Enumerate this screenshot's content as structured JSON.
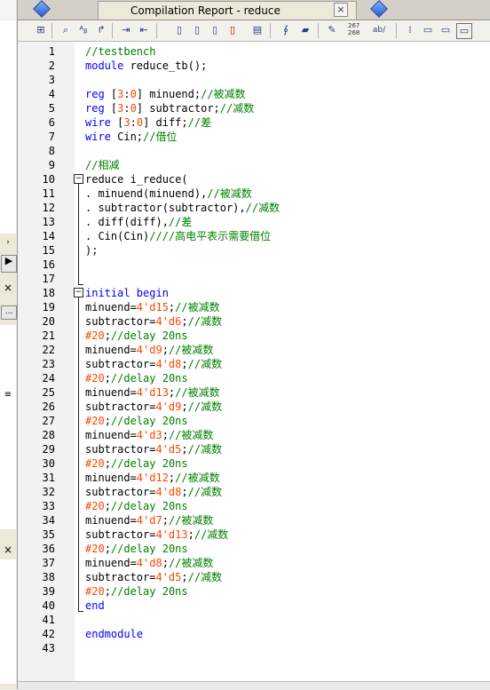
{
  "window": {
    "tab_title": "Compilation Report - reduce",
    "tab_close": "×"
  },
  "left_panel": {
    "close_glyph": "×",
    "ellipsis": "...",
    "scroll_glyph": "≡"
  },
  "toolbar": {
    "counter_top": "267",
    "counter_bottom": "268",
    "ab_label": "ab/",
    "icons": [
      "insert-template-icon",
      "find-icon",
      "find-replace-icon",
      "goto-icon",
      "indent-icon",
      "unindent-icon",
      "bookmark-toggle-icon",
      "bookmark-next-icon",
      "bookmark-prev-icon",
      "bookmark-clear-icon",
      "bookmark-list-icon",
      "attach-icon",
      "comment-icon",
      "block-comment-icon",
      "line-numbers-icon",
      "word-wrap-icon",
      "cursor-icon",
      "align-left-icon",
      "align-right-icon",
      "toggle-view-icon"
    ]
  },
  "editor": {
    "lines": [
      {
        "n": "1",
        "t": [
          {
            "c": "cm",
            "s": "//testbench"
          }
        ]
      },
      {
        "n": "2",
        "t": [
          {
            "c": "kw",
            "s": "module"
          },
          {
            "c": "",
            "s": " reduce_tb();"
          }
        ]
      },
      {
        "n": "3",
        "t": []
      },
      {
        "n": "4",
        "t": [
          {
            "c": "kw",
            "s": "reg"
          },
          {
            "c": "",
            "s": " "
          },
          {
            "c": "",
            "s": "["
          },
          {
            "c": "nm",
            "s": "3"
          },
          {
            "c": "",
            "s": ":"
          },
          {
            "c": "nm",
            "s": "0"
          },
          {
            "c": "",
            "s": "] minuend;"
          },
          {
            "c": "cm",
            "s": "//被减数"
          }
        ]
      },
      {
        "n": "5",
        "t": [
          {
            "c": "kw",
            "s": "reg"
          },
          {
            "c": "",
            "s": " ["
          },
          {
            "c": "nm",
            "s": "3"
          },
          {
            "c": "",
            "s": ":"
          },
          {
            "c": "nm",
            "s": "0"
          },
          {
            "c": "",
            "s": "] subtractor;"
          },
          {
            "c": "cm",
            "s": "//减数"
          }
        ]
      },
      {
        "n": "6",
        "t": [
          {
            "c": "kw",
            "s": "wire"
          },
          {
            "c": "",
            "s": " ["
          },
          {
            "c": "nm",
            "s": "3"
          },
          {
            "c": "",
            "s": ":"
          },
          {
            "c": "nm",
            "s": "0"
          },
          {
            "c": "",
            "s": "] diff;"
          },
          {
            "c": "cm",
            "s": "//差"
          }
        ]
      },
      {
        "n": "7",
        "t": [
          {
            "c": "kw",
            "s": "wire"
          },
          {
            "c": "",
            "s": " Cin;"
          },
          {
            "c": "cm",
            "s": "//借位"
          }
        ]
      },
      {
        "n": "8",
        "t": []
      },
      {
        "n": "9",
        "t": [
          {
            "c": "cm",
            "s": "//相减"
          }
        ]
      },
      {
        "n": "10",
        "t": [
          {
            "c": "",
            "s": "reduce i_reduce("
          }
        ]
      },
      {
        "n": "11",
        "t": [
          {
            "c": "",
            "s": ". minuend(minuend),"
          },
          {
            "c": "cm",
            "s": "//被减数"
          }
        ]
      },
      {
        "n": "12",
        "t": [
          {
            "c": "",
            "s": ". subtractor(subtractor),"
          },
          {
            "c": "cm",
            "s": "//减数"
          }
        ]
      },
      {
        "n": "13",
        "t": [
          {
            "c": "",
            "s": ". diff(diff),"
          },
          {
            "c": "cm",
            "s": "//差"
          }
        ]
      },
      {
        "n": "14",
        "t": [
          {
            "c": "",
            "s": ". Cin(Cin)"
          },
          {
            "c": "cm",
            "s": "////高电平表示需要借位"
          }
        ]
      },
      {
        "n": "15",
        "t": [
          {
            "c": "",
            "s": ");"
          }
        ]
      },
      {
        "n": "16",
        "t": []
      },
      {
        "n": "17",
        "t": []
      },
      {
        "n": "18",
        "t": [
          {
            "c": "kw",
            "s": "initial begin"
          }
        ]
      },
      {
        "n": "19",
        "t": [
          {
            "c": "",
            "s": "minuend="
          },
          {
            "c": "nm",
            "s": "4'd15"
          },
          {
            "c": "",
            "s": ";"
          },
          {
            "c": "cm",
            "s": "//被减数"
          }
        ]
      },
      {
        "n": "20",
        "t": [
          {
            "c": "",
            "s": "subtractor="
          },
          {
            "c": "nm",
            "s": "4'd6"
          },
          {
            "c": "",
            "s": ";"
          },
          {
            "c": "cm",
            "s": "//减数"
          }
        ]
      },
      {
        "n": "21",
        "t": [
          {
            "c": "nm",
            "s": "#20"
          },
          {
            "c": "",
            "s": ";"
          },
          {
            "c": "cm",
            "s": "//delay 20ns"
          }
        ]
      },
      {
        "n": "22",
        "t": [
          {
            "c": "",
            "s": "minuend="
          },
          {
            "c": "nm",
            "s": "4'd9"
          },
          {
            "c": "",
            "s": ";"
          },
          {
            "c": "cm",
            "s": "//被减数"
          }
        ]
      },
      {
        "n": "23",
        "t": [
          {
            "c": "",
            "s": "subtractor="
          },
          {
            "c": "nm",
            "s": "4'd8"
          },
          {
            "c": "",
            "s": ";"
          },
          {
            "c": "cm",
            "s": "//减数"
          }
        ]
      },
      {
        "n": "24",
        "t": [
          {
            "c": "nm",
            "s": "#20"
          },
          {
            "c": "",
            "s": ";"
          },
          {
            "c": "cm",
            "s": "//delay 20ns"
          }
        ]
      },
      {
        "n": "25",
        "t": [
          {
            "c": "",
            "s": "minuend="
          },
          {
            "c": "nm",
            "s": "4'd13"
          },
          {
            "c": "",
            "s": ";"
          },
          {
            "c": "cm",
            "s": "//被减数"
          }
        ]
      },
      {
        "n": "26",
        "t": [
          {
            "c": "",
            "s": "subtractor="
          },
          {
            "c": "nm",
            "s": "4'd9"
          },
          {
            "c": "",
            "s": ";"
          },
          {
            "c": "cm",
            "s": "//减数"
          }
        ]
      },
      {
        "n": "27",
        "t": [
          {
            "c": "nm",
            "s": "#20"
          },
          {
            "c": "",
            "s": ";"
          },
          {
            "c": "cm",
            "s": "//delay 20ns"
          }
        ]
      },
      {
        "n": "28",
        "t": [
          {
            "c": "",
            "s": "minuend="
          },
          {
            "c": "nm",
            "s": "4'd3"
          },
          {
            "c": "",
            "s": ";"
          },
          {
            "c": "cm",
            "s": "//被减数"
          }
        ]
      },
      {
        "n": "29",
        "t": [
          {
            "c": "",
            "s": "subtractor="
          },
          {
            "c": "nm",
            "s": "4'd5"
          },
          {
            "c": "",
            "s": ";"
          },
          {
            "c": "cm",
            "s": "//减数"
          }
        ]
      },
      {
        "n": "30",
        "t": [
          {
            "c": "nm",
            "s": "#20"
          },
          {
            "c": "",
            "s": ";"
          },
          {
            "c": "cm",
            "s": "//delay 20ns"
          }
        ]
      },
      {
        "n": "31",
        "t": [
          {
            "c": "",
            "s": "minuend="
          },
          {
            "c": "nm",
            "s": "4'd12"
          },
          {
            "c": "",
            "s": ";"
          },
          {
            "c": "cm",
            "s": "//被减数"
          }
        ]
      },
      {
        "n": "32",
        "t": [
          {
            "c": "",
            "s": "subtractor="
          },
          {
            "c": "nm",
            "s": "4'd8"
          },
          {
            "c": "",
            "s": ";"
          },
          {
            "c": "cm",
            "s": "//减数"
          }
        ]
      },
      {
        "n": "33",
        "t": [
          {
            "c": "nm",
            "s": "#20"
          },
          {
            "c": "",
            "s": ";"
          },
          {
            "c": "cm",
            "s": "//delay 20ns"
          }
        ]
      },
      {
        "n": "34",
        "t": [
          {
            "c": "",
            "s": "minuend="
          },
          {
            "c": "nm",
            "s": "4'd7"
          },
          {
            "c": "",
            "s": ";"
          },
          {
            "c": "cm",
            "s": "//被减数"
          }
        ]
      },
      {
        "n": "35",
        "t": [
          {
            "c": "",
            "s": "subtractor="
          },
          {
            "c": "nm",
            "s": "4'd13"
          },
          {
            "c": "",
            "s": ";"
          },
          {
            "c": "cm",
            "s": "//减数"
          }
        ]
      },
      {
        "n": "36",
        "t": [
          {
            "c": "nm",
            "s": "#20"
          },
          {
            "c": "",
            "s": ";"
          },
          {
            "c": "cm",
            "s": "//delay 20ns"
          }
        ]
      },
      {
        "n": "37",
        "t": [
          {
            "c": "",
            "s": "minuend="
          },
          {
            "c": "nm",
            "s": "4'd8"
          },
          {
            "c": "",
            "s": ";"
          },
          {
            "c": "cm",
            "s": "//被减数"
          }
        ]
      },
      {
        "n": "38",
        "t": [
          {
            "c": "",
            "s": "subtractor="
          },
          {
            "c": "nm",
            "s": "4'd5"
          },
          {
            "c": "",
            "s": ";"
          },
          {
            "c": "cm",
            "s": "//减数"
          }
        ]
      },
      {
        "n": "39",
        "t": [
          {
            "c": "nm",
            "s": "#20"
          },
          {
            "c": "",
            "s": ";"
          },
          {
            "c": "cm",
            "s": "//delay 20ns"
          }
        ]
      },
      {
        "n": "40",
        "t": [
          {
            "c": "kw",
            "s": "end"
          }
        ]
      },
      {
        "n": "41",
        "t": []
      },
      {
        "n": "42",
        "t": [
          {
            "c": "kw",
            "s": "endmodule"
          }
        ]
      },
      {
        "n": "43",
        "t": []
      }
    ]
  }
}
